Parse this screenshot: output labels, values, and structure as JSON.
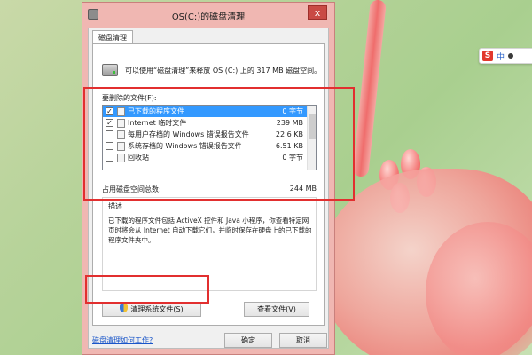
{
  "window": {
    "title": "OS(C:)的磁盘清理",
    "close_glyph": "x"
  },
  "tabs": [
    {
      "label": "磁盘清理"
    }
  ],
  "summary_text": "可以使用“磁盘清理”来释放 OS (C:) 上的 317 MB 磁盘空间。",
  "files_label": "要删除的文件(F):",
  "files": [
    {
      "name": "已下载的程序文件",
      "size": "0 字节",
      "checked": true,
      "selected": true
    },
    {
      "name": "Internet 临时文件",
      "size": "239 MB",
      "checked": true,
      "selected": false
    },
    {
      "name": "每用户存档的 Windows 错误报告文件",
      "size": "22.6 KB",
      "checked": false,
      "selected": false
    },
    {
      "name": "系统存档的 Windows 错误报告文件",
      "size": "6.51 KB",
      "checked": false,
      "selected": false
    },
    {
      "name": "回收站",
      "size": "0 字节",
      "checked": false,
      "selected": false
    }
  ],
  "total": {
    "label": "占用磁盘空间总数:",
    "value": "244 MB"
  },
  "description": {
    "title": "描述",
    "body": "已下载的程序文件包括 ActiveX 控件和 Java 小程序，你查看特定网页时将会从 Internet 自动下载它们，并临时保存在硬盘上的已下载的程序文件夹中。"
  },
  "buttons": {
    "clean_system": "清理系统文件(S)",
    "view_files": "查看文件(V)",
    "ok": "确定",
    "cancel": "取消"
  },
  "help_link": "磁盘清理如何工作?",
  "ime": {
    "logo": "S",
    "mode": "中"
  },
  "colors": {
    "highlight_box": "#e22f2f",
    "selection": "#3399ff",
    "link": "#1a56c9"
  }
}
